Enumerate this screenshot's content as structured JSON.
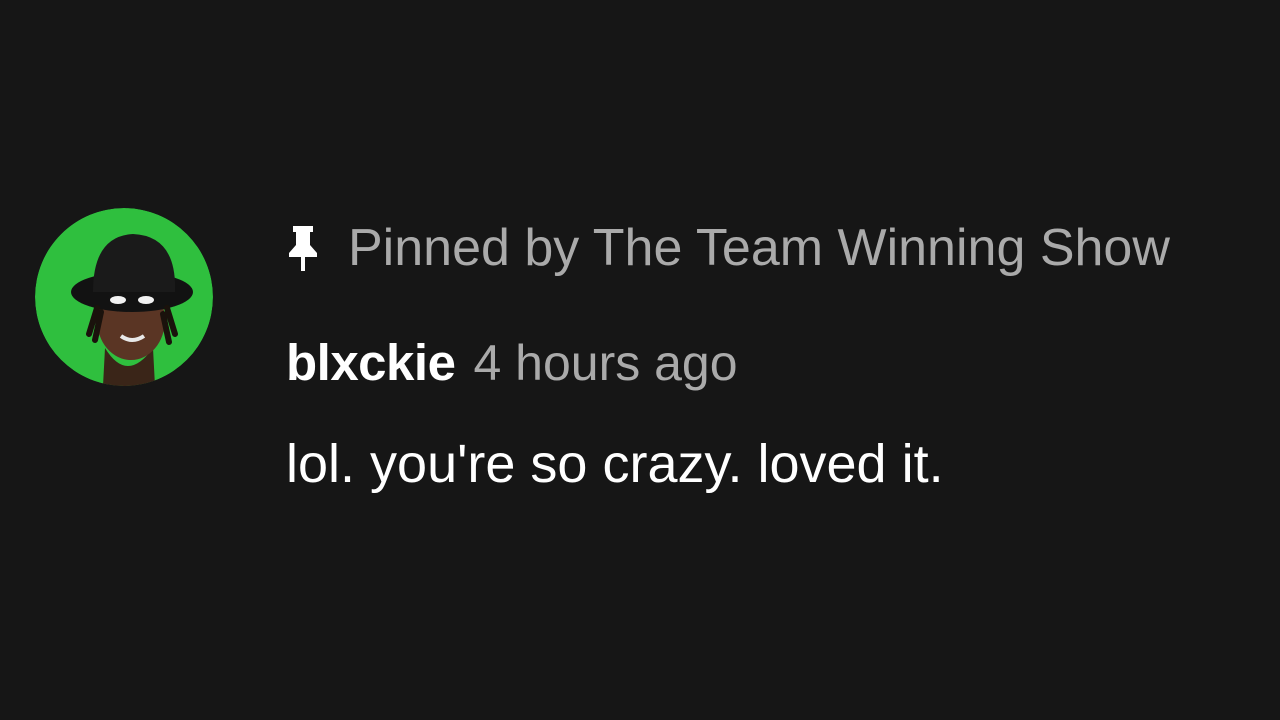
{
  "comment": {
    "pinned_icon": "pin-icon",
    "pinned_text": "Pinned by The Team Winning Show",
    "author": "blxckie",
    "timestamp": "4 hours ago",
    "text": "lol. you're so crazy. loved it."
  },
  "colors": {
    "background": "#161616",
    "avatar_ring": "#2ec240",
    "secondary_text": "#aaaaaa",
    "primary_text": "#ffffff"
  }
}
